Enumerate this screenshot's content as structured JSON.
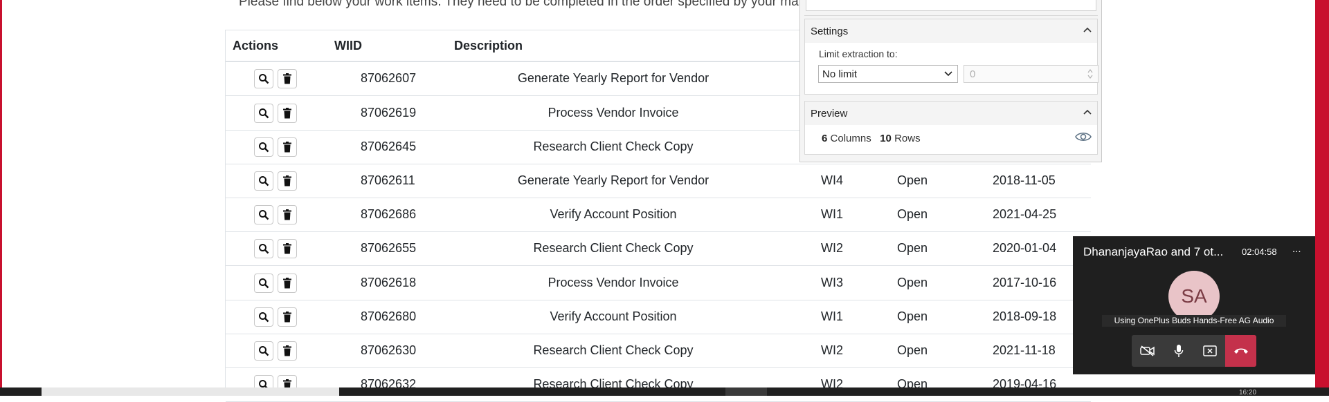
{
  "page": {
    "intro_text": "Please find below your work items. They need to be completed in the order specified by your manager."
  },
  "table": {
    "headers": {
      "actions": "Actions",
      "wiid": "WIID",
      "description": "Description"
    },
    "rows": [
      {
        "wiid": "87062607",
        "description": "Generate Yearly Report for Vendor",
        "type": "",
        "status": "",
        "date": ""
      },
      {
        "wiid": "87062619",
        "description": "Process Vendor Invoice",
        "type": "",
        "status": "",
        "date": ""
      },
      {
        "wiid": "87062645",
        "description": "Research Client Check Copy",
        "type": "",
        "status": "",
        "date": ""
      },
      {
        "wiid": "87062611",
        "description": "Generate Yearly Report for Vendor",
        "type": "WI4",
        "status": "Open",
        "date": "2018-11-05"
      },
      {
        "wiid": "87062686",
        "description": "Verify Account Position",
        "type": "WI1",
        "status": "Open",
        "date": "2021-04-25"
      },
      {
        "wiid": "87062655",
        "description": "Research Client Check Copy",
        "type": "WI2",
        "status": "Open",
        "date": "2020-01-04"
      },
      {
        "wiid": "87062618",
        "description": "Process Vendor Invoice",
        "type": "WI3",
        "status": "Open",
        "date": "2017-10-16"
      },
      {
        "wiid": "87062680",
        "description": "Verify Account Position",
        "type": "WI1",
        "status": "Open",
        "date": "2018-09-18"
      },
      {
        "wiid": "87062630",
        "description": "Research Client Check Copy",
        "type": "WI2",
        "status": "Open",
        "date": "2021-11-18"
      },
      {
        "wiid": "87062632",
        "description": "Research Client Check Copy",
        "type": "WI2",
        "status": "Open",
        "date": "2019-04-16"
      }
    ]
  },
  "extraction_panel": {
    "settings_title": "Settings",
    "limit_label": "Limit extraction to:",
    "limit_select_value": "No limit",
    "limit_number_value": "0",
    "preview_title": "Preview",
    "columns_count": "6",
    "columns_label": "Columns",
    "rows_count": "10",
    "rows_label": "Rows"
  },
  "call": {
    "title": "DhananjayaRao and 7 ot...",
    "duration": "02:04:58",
    "minimize_label": "...",
    "avatar_initials": "SA",
    "audio_note": "Using OnePlus Buds Hands-Free AG Audio"
  },
  "taskbar": {
    "clock": "16:20"
  },
  "colors": {
    "frame_red": "#c8102e",
    "hangup_red": "#c4314b",
    "call_bg": "#1f1f1f",
    "avatar_bg": "#e9c4c8"
  }
}
